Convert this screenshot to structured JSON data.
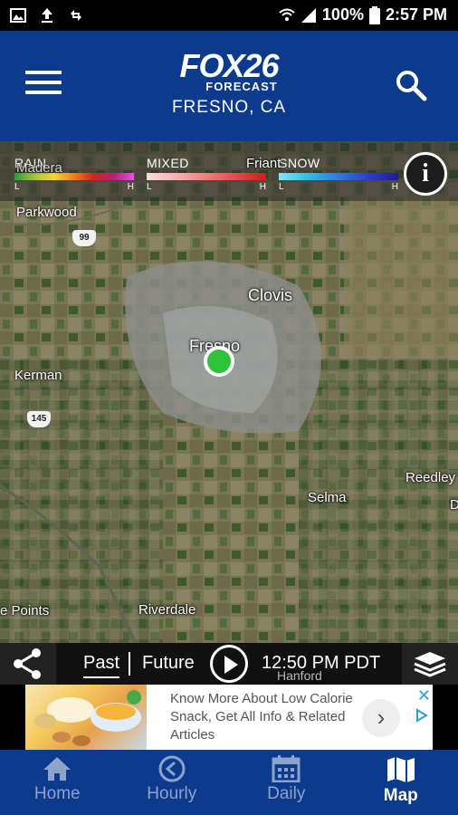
{
  "status_bar": {
    "battery": "100%",
    "time": "2:57 PM"
  },
  "header": {
    "brand": "FOX26",
    "brand_sub": "FORECAST",
    "city": "FRESNO, CA"
  },
  "legend": {
    "rain": {
      "label": "RAIN",
      "low": "L",
      "high": "H"
    },
    "mixed": {
      "label": "MIXED",
      "low": "L",
      "high": "H"
    },
    "snow": {
      "label": "SNOW",
      "low": "L",
      "high": "H"
    },
    "info": "i"
  },
  "map": {
    "places": {
      "madera": "Madera",
      "friant": "Friant",
      "parkwood": "Parkwood",
      "clovis": "Clovis",
      "fresno": "Fresno",
      "kerman": "Kerman",
      "reedley": "Reedley",
      "selma": "Selma",
      "points": "e Points",
      "riverdale": "Riverdale",
      "hanford": "Hanford",
      "dinuba": "D"
    },
    "routes": {
      "r99": "99",
      "r145": "145"
    }
  },
  "controls": {
    "past": "Past",
    "future": "Future",
    "time": "12:50 PM PDT"
  },
  "ad": {
    "text": "Know More About Low Calorie Snack, Get All Info & Related Articles",
    "arrow": "›",
    "close": "✕"
  },
  "nav": [
    {
      "label": "Home"
    },
    {
      "label": "Hourly"
    },
    {
      "label": "Daily"
    },
    {
      "label": "Map"
    }
  ]
}
